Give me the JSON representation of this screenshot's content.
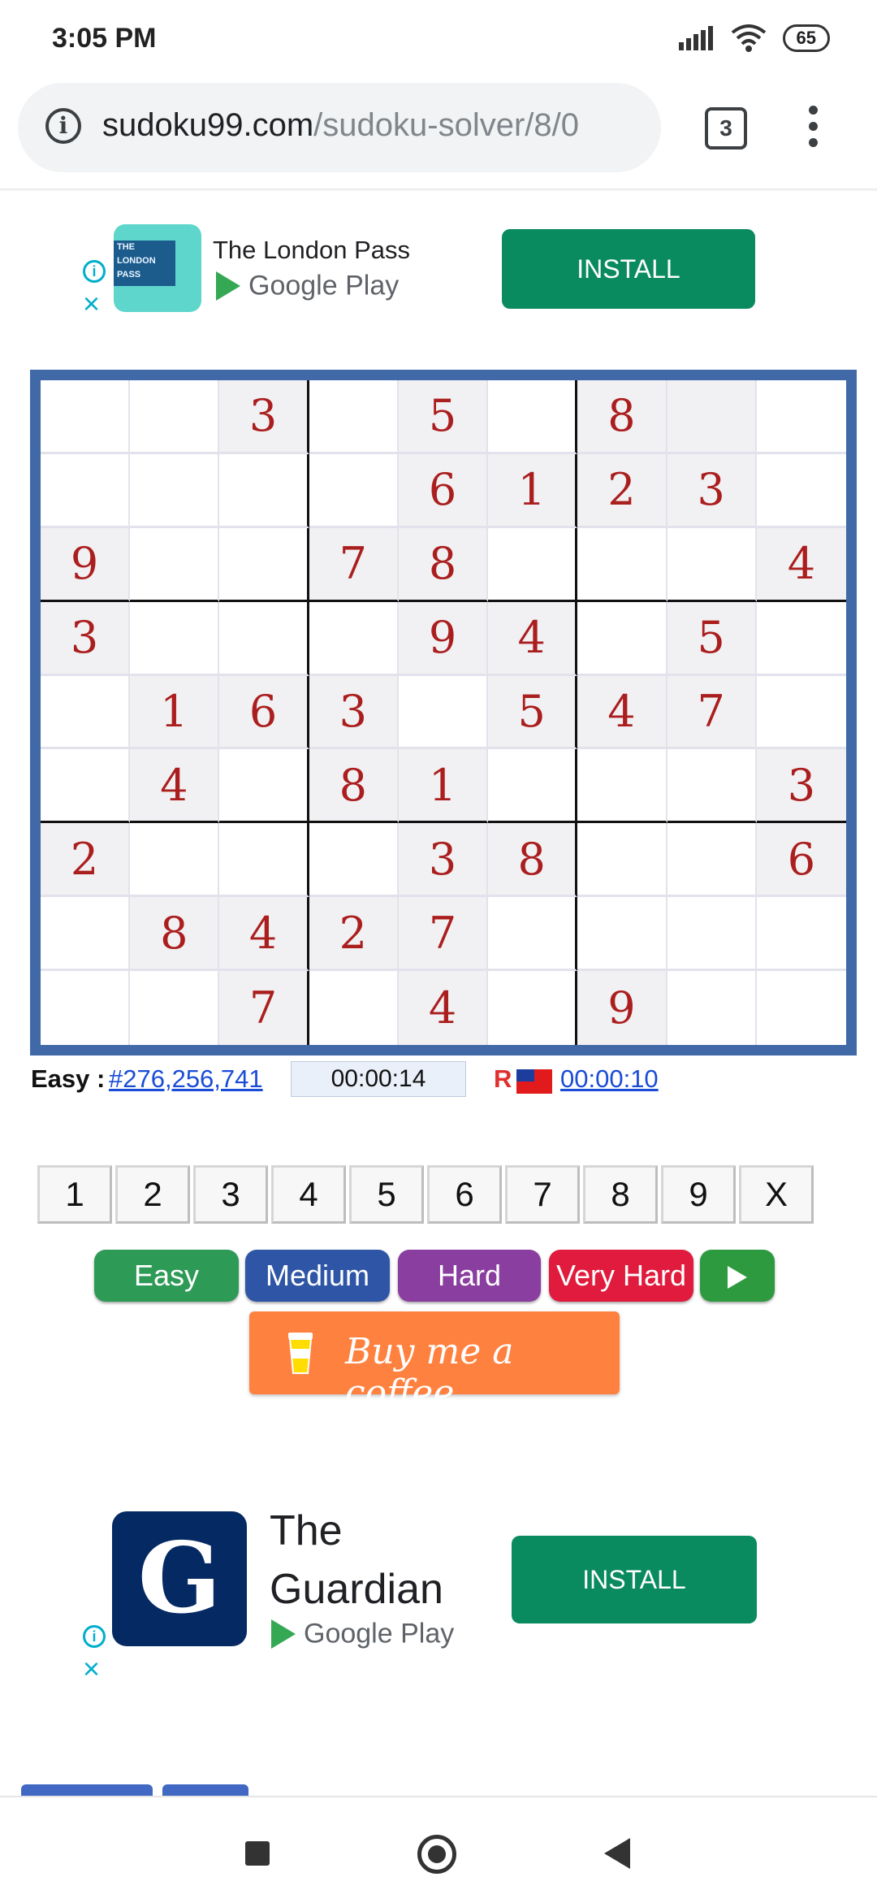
{
  "status_bar": {
    "time": "3:05 PM",
    "battery": "65"
  },
  "browser": {
    "url_host": "sudoku99.com",
    "url_path": "/sudoku-solver/8/0",
    "tab_count": "3"
  },
  "ad_top": {
    "logo_text": "THE LONDON PASS",
    "title": "The London Pass",
    "store": "Google Play",
    "install_label": "INSTALL"
  },
  "sudoku": {
    "rows": [
      [
        "",
        "",
        "3",
        "",
        "5",
        "",
        "8",
        "",
        ""
      ],
      [
        "",
        "",
        "",
        "",
        "6",
        "1",
        "2",
        "3",
        ""
      ],
      [
        "9",
        "",
        "",
        "7",
        "8",
        "",
        "",
        "",
        "4"
      ],
      [
        "3",
        "",
        "",
        "",
        "9",
        "4",
        "",
        "5",
        ""
      ],
      [
        "",
        "1",
        "6",
        "3",
        "",
        "5",
        "4",
        "7",
        ""
      ],
      [
        "",
        "4",
        "",
        "8",
        "1",
        "",
        "",
        "",
        "3"
      ],
      [
        "2",
        "",
        "",
        "",
        "3",
        "8",
        "",
        "",
        "6"
      ],
      [
        "",
        "8",
        "4",
        "2",
        "7",
        "",
        "",
        "",
        ""
      ],
      [
        "",
        "",
        "7",
        "",
        "4",
        "",
        "9",
        "",
        ""
      ]
    ],
    "shaded": [
      [
        0,
        0,
        1,
        0,
        1,
        0,
        1,
        1,
        0
      ],
      [
        0,
        0,
        0,
        0,
        1,
        1,
        1,
        1,
        0
      ],
      [
        1,
        0,
        0,
        1,
        1,
        0,
        0,
        0,
        1
      ],
      [
        1,
        0,
        0,
        0,
        1,
        1,
        0,
        1,
        0
      ],
      [
        0,
        1,
        1,
        1,
        0,
        1,
        1,
        1,
        0
      ],
      [
        0,
        1,
        0,
        1,
        1,
        0,
        0,
        0,
        1
      ],
      [
        1,
        0,
        0,
        0,
        1,
        1,
        0,
        0,
        1
      ],
      [
        0,
        1,
        1,
        1,
        1,
        0,
        0,
        0,
        0
      ],
      [
        0,
        0,
        1,
        0,
        1,
        0,
        1,
        0,
        0
      ]
    ]
  },
  "info": {
    "level_label": "Easy :",
    "puzzle_id": "#276,256,741",
    "timer": "00:00:14",
    "record_label": "R",
    "record_time": "00:00:10"
  },
  "numpad": [
    "1",
    "2",
    "3",
    "4",
    "5",
    "6",
    "7",
    "8",
    "9",
    "X"
  ],
  "difficulty": {
    "easy": "Easy",
    "medium": "Medium",
    "hard": "Hard",
    "very_hard": "Very Hard"
  },
  "coffee_label": "Buy me a coffee",
  "ad_bottom": {
    "logo_letter": "G",
    "title": "The Guardian",
    "store": "Google Play",
    "install_label": "INSTALL"
  },
  "colors": {
    "board_frame": "#4169a8",
    "given_digit": "#ab1e1e",
    "install_green": "#0a8a5f",
    "coffee_orange": "#ff813f"
  }
}
